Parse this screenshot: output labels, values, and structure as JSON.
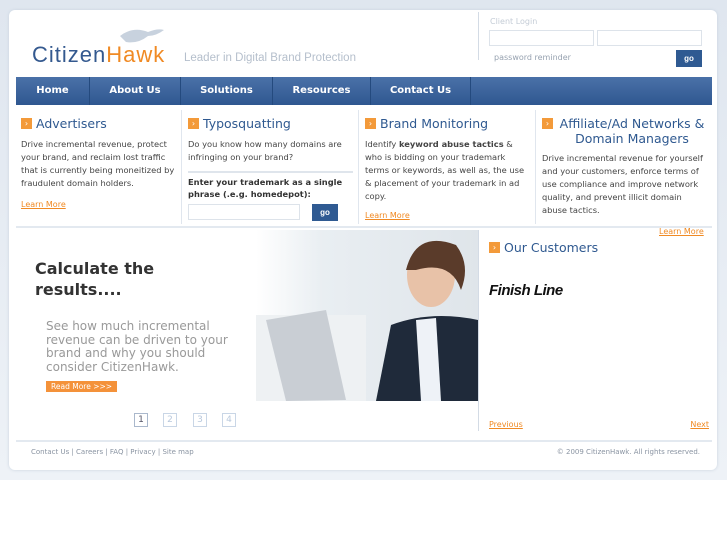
{
  "brand": {
    "name_part1": "Citizen",
    "name_part2": "Hawk",
    "tagline": "Leader in Digital Brand Protection",
    "accent": "#f08a24",
    "primary": "#2f5a92"
  },
  "login": {
    "label": "Client Login",
    "username_value": "",
    "password_value": "",
    "reminder": "password reminder",
    "go": "go"
  },
  "nav": [
    "Home",
    "About Us",
    "Solutions",
    "Resources",
    "Contact Us"
  ],
  "columns": {
    "advertisers": {
      "title": "Advertisers",
      "text": "Drive incremental revenue, protect your brand, and reclaim lost traffic that is currently being moneitized by fraudulent domain holders.",
      "link": "Learn More"
    },
    "typosquatting": {
      "title": "Typosquatting",
      "text": "Do you know how many domains are infringing on your brand?",
      "prompt": "Enter your trademark as a single phrase (.e.g. homedepot):",
      "input_value": "",
      "go": "go"
    },
    "brand_monitoring": {
      "title": "Brand Monitoring",
      "text_pre": "Identify ",
      "text_bold": "keyword abuse tactics",
      "text_post": " & who is bidding on your trademark terms or keywords, as well as, the use & placement of your trademark in ad copy.",
      "link": "Learn More"
    },
    "affiliate": {
      "title": "Affiliate/Ad Networks & Domain Managers",
      "text": "Drive incremental revenue for yourself and your customers, enforce terms of use compliance and improve network quality, and prevent illicit domain abuse tactics.",
      "link": "Learn More"
    }
  },
  "hero": {
    "title": "Calculate the results....",
    "text": "See how much incremental revenue can be driven to your brand and why you should consider CitizenHawk.",
    "button": "Read More >>>",
    "pages": [
      "1",
      "2",
      "3",
      "4"
    ],
    "current_page": "1"
  },
  "customers": {
    "title": "Our Customers",
    "logo": "Finish Line",
    "previous": "Previous",
    "next": "Next"
  },
  "footer": {
    "links": [
      "Contact Us",
      "Careers",
      "FAQ",
      "Privacy",
      "Site map"
    ],
    "copyright": "© 2009 CitizenHawk. All rights reserved."
  }
}
